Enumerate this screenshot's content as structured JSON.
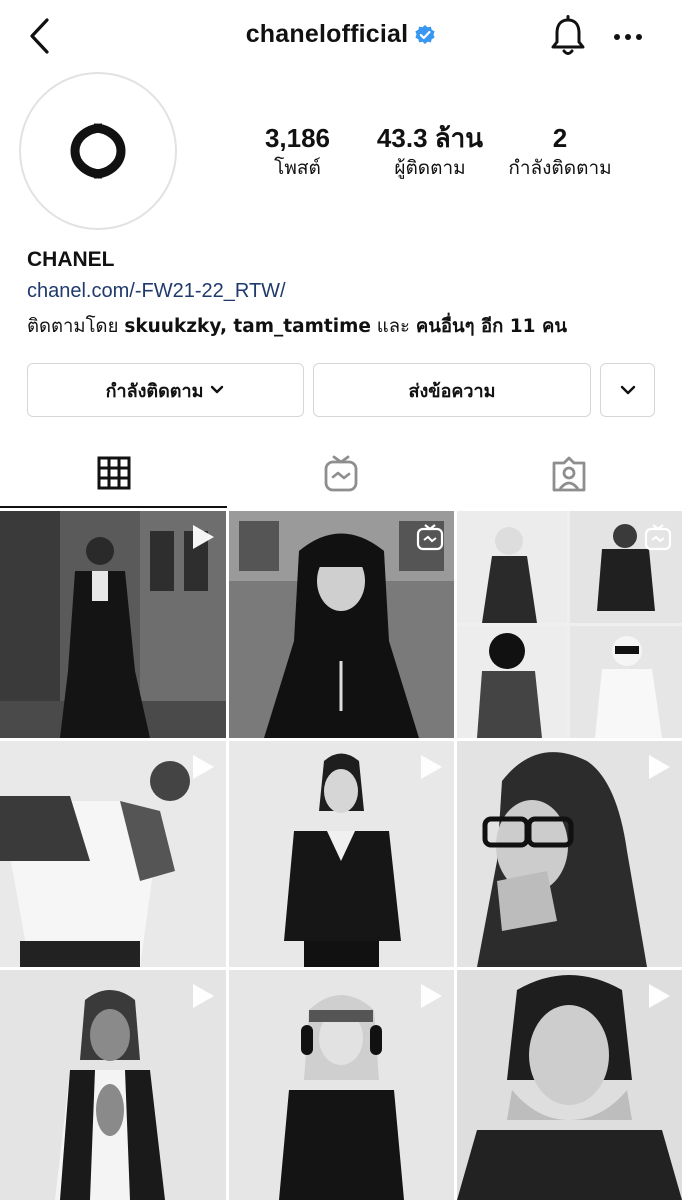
{
  "header": {
    "username": "chanelofficial",
    "icons": {
      "back": "chevron-left-icon",
      "verified": "verified-badge-icon",
      "notifications": "bell-icon",
      "more": "more-horizontal-icon"
    }
  },
  "profile": {
    "name": "CHANEL",
    "link": "chanel.com/-FW21-22_RTW/",
    "followed_by_prefix": "ติดตามโดย",
    "followed_by_users": "skuukzky, tam_tamtime",
    "followed_by_and": "และ",
    "followed_by_others": "คนอื่นๆ อีก 11 คน",
    "stats": [
      {
        "value": "3,186",
        "label": "โพสต์"
      },
      {
        "value": "43.3 ล้าน",
        "label": "ผู้ติดตาม"
      },
      {
        "value": "2",
        "label": "กำลังติดตาม"
      }
    ]
  },
  "actions": {
    "following_label": "กำลังติดตาม",
    "message_label": "ส่งข้อความ"
  },
  "tabs": [
    {
      "icon": "grid-icon",
      "active": true
    },
    {
      "icon": "igtv-icon",
      "active": false
    },
    {
      "icon": "tagged-user-icon",
      "active": false
    }
  ],
  "posts": [
    {
      "type": "video"
    },
    {
      "type": "igtv"
    },
    {
      "type": "igtv"
    },
    {
      "type": "video"
    },
    {
      "type": "video"
    },
    {
      "type": "video"
    },
    {
      "type": "video"
    },
    {
      "type": "video"
    },
    {
      "type": "video"
    }
  ],
  "colors": {
    "link": "#1f3a6b",
    "verified": "#3897f0",
    "border": "#d6d6d6"
  }
}
